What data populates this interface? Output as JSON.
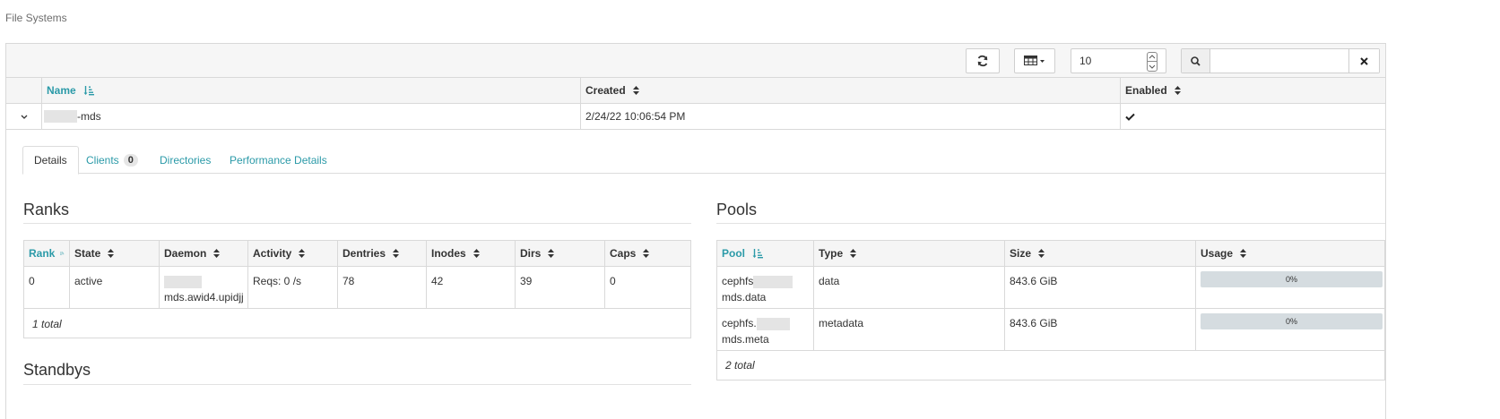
{
  "page": {
    "title": "File Systems"
  },
  "toolbar": {
    "refresh_icon": "refresh-icon",
    "columns_icon": "table-columns-icon",
    "page_size": "10",
    "search_icon": "search-icon",
    "search_value": "",
    "clear_icon": "close-icon"
  },
  "fs_table": {
    "headers": {
      "name": "Name",
      "created": "Created",
      "enabled": "Enabled"
    },
    "rows": [
      {
        "name_suffix": "-mds",
        "created": "2/24/22 10:06:54 PM",
        "enabled_icon": "check-icon"
      }
    ]
  },
  "tabs": [
    {
      "label": "Details"
    },
    {
      "label": "Clients",
      "badge": "0"
    },
    {
      "label": "Directories"
    },
    {
      "label": "Performance Details"
    }
  ],
  "ranks": {
    "title": "Ranks",
    "headers": [
      "Rank",
      "State",
      "Daemon",
      "Activity",
      "Dentries",
      "Inodes",
      "Dirs",
      "Caps"
    ],
    "rows": [
      {
        "rank": "0",
        "state": "active",
        "daemon": "mds.awid4.upidjj",
        "activity": "Reqs: 0 /s",
        "dentries": "78",
        "inodes": "42",
        "dirs": "39",
        "caps": "0"
      }
    ],
    "footer": "1 total"
  },
  "standbys": {
    "title": "Standbys"
  },
  "pools": {
    "title": "Pools",
    "headers": [
      "Pool",
      "Type",
      "Size",
      "Usage"
    ],
    "rows": [
      {
        "pool_prefix": "cephfs",
        "pool_suffix": "mds.data",
        "type": "data",
        "size": "843.6 GiB",
        "usage_label": "0%",
        "usage": 0
      },
      {
        "pool_prefix": "cephfs.",
        "pool_suffix": "mds.meta",
        "type": "metadata",
        "size": "843.6 GiB",
        "usage_label": "0%",
        "usage": 0
      }
    ],
    "footer": "2 total"
  },
  "colors": {
    "accent": "#2b9aa8",
    "border": "#d9d9d9",
    "header_bg": "#f5f5f5"
  }
}
